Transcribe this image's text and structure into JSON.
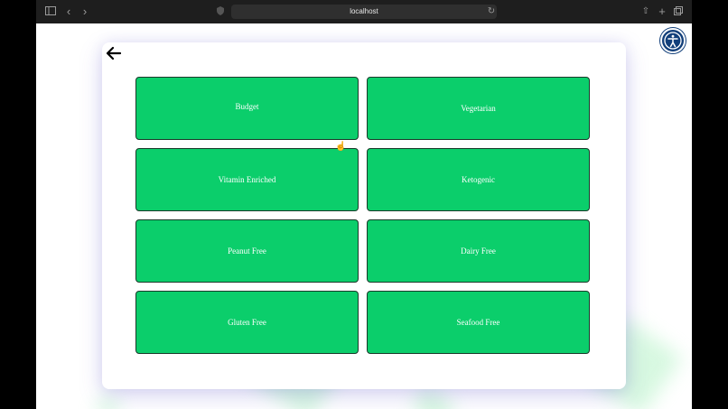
{
  "browser": {
    "url": "localhost",
    "icons": [
      "sidebar-icon",
      "back-icon",
      "forward-icon",
      "shield-icon",
      "reload-icon",
      "share-icon",
      "new-tab-icon",
      "tabs-icon"
    ]
  },
  "page": {
    "back_icon": "back-arrow-icon",
    "accessibility_icon": "accessibility-icon",
    "colors": {
      "tile": "#0bce6b",
      "accessibility": "#123f7a"
    },
    "categories": [
      {
        "label": "Budget"
      },
      {
        "label": "Vegetarian"
      },
      {
        "label": "Vitamin Enriched"
      },
      {
        "label": "Ketogenic"
      },
      {
        "label": "Peanut Free"
      },
      {
        "label": "Dairy Free"
      },
      {
        "label": "Gluten Free"
      },
      {
        "label": "Seafood Free"
      }
    ]
  }
}
